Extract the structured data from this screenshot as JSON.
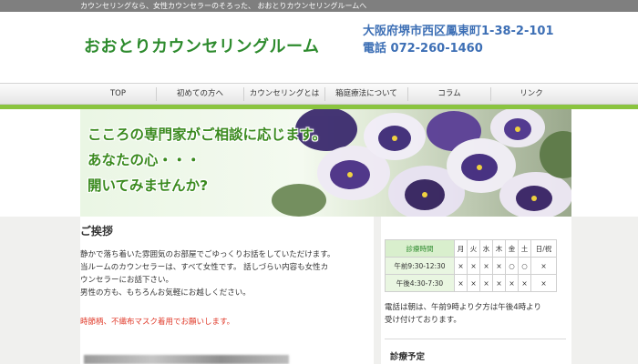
{
  "topbar": {
    "text": "カウンセリングなら、女性カウンセラーのそろった、 おおとりカウンセリングルームへ"
  },
  "header": {
    "title": "おおとりカウンセリングルーム",
    "address": "大阪府堺市西区鳳東町1-38-2-101",
    "phone": "電話 072-260-1460"
  },
  "nav": {
    "items": [
      {
        "label": "TOP"
      },
      {
        "label": "初めての方へ"
      },
      {
        "label": "カウンセリングとは"
      },
      {
        "label": "箱庭療法について"
      },
      {
        "label": "コラム"
      },
      {
        "label": "リンク"
      }
    ]
  },
  "hero": {
    "lines": [
      "こころの専門家がご相談に応じます。",
      "あなたの心・・・",
      "開いてみませんか?"
    ]
  },
  "greeting": {
    "title": "ご挨拶",
    "lines": [
      "静かで落ち着いた雰囲気のお部屋でごゆっくりお話をしていただけます。",
      "当ルームのカウンセラーは、すべて女性です。 話しづらい内容も女性カ",
      "ウンセラーにお話下さい。",
      "男性の方も、もちろんお気軽にお越しください。"
    ],
    "notice": "時節柄、不織布マスク着用でお願いします。"
  },
  "hours": {
    "header": "診療時間",
    "days": [
      "月",
      "火",
      "水",
      "木",
      "金",
      "土",
      "日/祝"
    ],
    "rows": [
      {
        "label": "午前9:30-12:30",
        "cells": [
          "×",
          "×",
          "×",
          "×",
          "○",
          "○",
          "×"
        ]
      },
      {
        "label": "午後4:30-7:30",
        "cells": [
          "×",
          "×",
          "×",
          "×",
          "×",
          "×",
          "×"
        ]
      }
    ],
    "note_lines": [
      "電話は朝は、午前9時より夕方は午後4時より",
      "受け付けております。"
    ]
  },
  "schedule": {
    "title": "診療予定"
  },
  "colors": {
    "brand_green": "#2e8b2e",
    "accent_band": "#8ac43f",
    "contact_blue": "#3d6fb5",
    "notice_red": "#e03a2a"
  }
}
